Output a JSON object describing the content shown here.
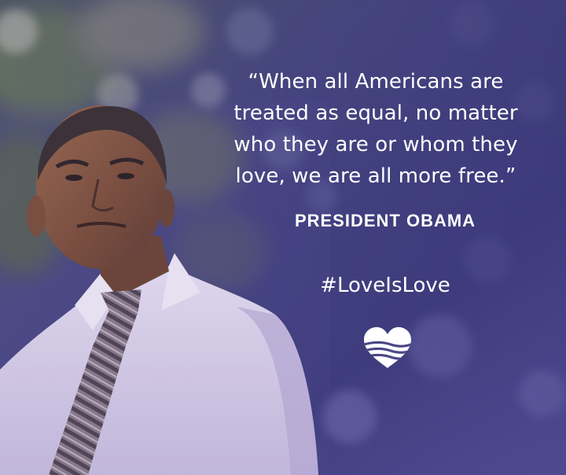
{
  "quote": {
    "lines": [
      "“When all Americans are",
      "treated as equal, no matter",
      "who they are or whom they",
      "love, we are all more free.”"
    ]
  },
  "attribution": "PRESIDENT OBAMA",
  "hashtag": "#LoveIsLove",
  "logo": {
    "icon": "striped-heart-icon",
    "color": "#ffffff"
  },
  "colors": {
    "overlay_dark": "#3b3a78",
    "overlay_light": "#8c80c8",
    "text": "#ffffff"
  }
}
